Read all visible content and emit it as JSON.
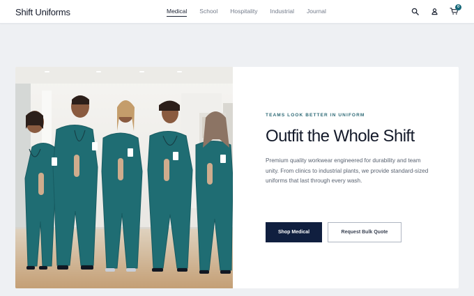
{
  "brand": {
    "name": "Shift Uniforms"
  },
  "nav": {
    "items": [
      {
        "label": "Medical",
        "active": true
      },
      {
        "label": "School",
        "active": false
      },
      {
        "label": "Hospitality",
        "active": false
      },
      {
        "label": "Industrial",
        "active": false
      },
      {
        "label": "Journal",
        "active": false
      }
    ]
  },
  "header_icons": {
    "search": "search-icon",
    "account": "user-icon",
    "cart": "cart-icon",
    "cart_count": "0"
  },
  "hero": {
    "eyebrow": "TEAMS LOOK BETTER IN UNIFORM",
    "headline": "Outfit the Whole Shift",
    "body": "Premium quality workwear engineered for durability and team unity. From clinics to industrial plants, we provide standard-sized uniforms that last through every wash.",
    "primary_cta": "Shop Medical",
    "secondary_cta": "Request Bulk Quote"
  },
  "colors": {
    "accent": "#16697a",
    "navy": "#101f3f",
    "page_background": "#eef0f3"
  }
}
